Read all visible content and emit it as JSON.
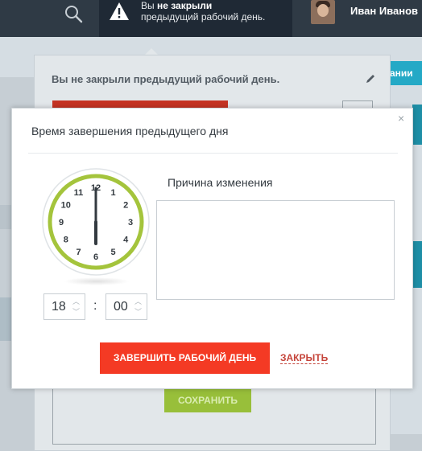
{
  "topbar": {
    "icons": {
      "search": "search-icon",
      "warning": "warning-icon"
    },
    "notice": {
      "line1_prefix": "Вы ",
      "line1_bold": "не закрыли",
      "line2": "предыдущий рабочий день."
    },
    "user": {
      "name": "Иван Иванов"
    }
  },
  "background": {
    "tab_label": "ании",
    "dropdown": {
      "title": "Вы не закрыли предыдущий рабочий день.",
      "edit_icon": "pencil-icon",
      "save_label": "СОХРАНИТЬ"
    }
  },
  "modal": {
    "title": "Время завершения предыдущего дня",
    "close_symbol": "×",
    "clock": {
      "numbers": [
        "12",
        "1",
        "2",
        "3",
        "4",
        "5",
        "6",
        "7",
        "8",
        "9",
        "10",
        "11"
      ],
      "hour": 18,
      "minute": 0,
      "ring_color": "#a4c43c"
    },
    "time": {
      "hours": "18",
      "minutes": "00",
      "separator": ":",
      "up_symbol": "︿",
      "down_symbol": "﹀"
    },
    "reason": {
      "label": "Причина изменения",
      "value": ""
    },
    "buttons": {
      "finish": "ЗАВЕРШИТЬ РАБОЧИЙ ДЕНЬ",
      "close": "ЗАКРЫТЬ"
    }
  },
  "colors": {
    "topbar": "#2f3a45",
    "primary_red": "#f43a24",
    "link_red": "#c5443a",
    "green": "#98bf3a",
    "teal": "#24a9c6"
  }
}
